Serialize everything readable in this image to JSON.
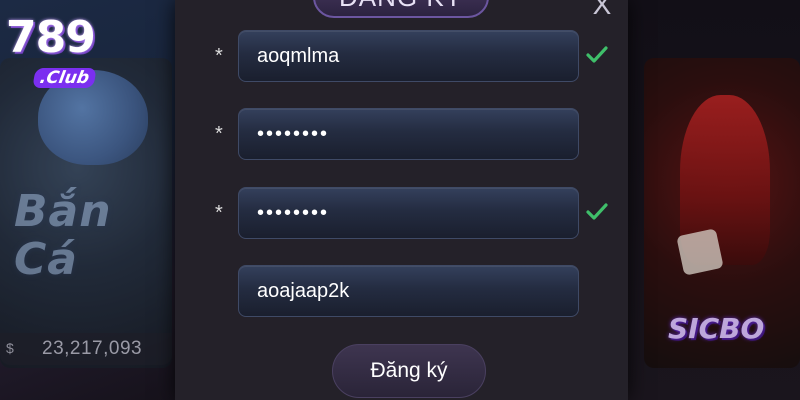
{
  "background": {
    "left_game": {
      "title": "Bắn Cá",
      "jackpot_currency": "$",
      "jackpot_amount": "23,217,093"
    },
    "right_game": {
      "title": "SICBO"
    },
    "logo": {
      "number": "789",
      "suffix": ".Club"
    }
  },
  "modal": {
    "title": "ĐĂNG KÝ",
    "close_label": "X",
    "fields": [
      {
        "required": "*",
        "value": "aoqmlma",
        "type": "username",
        "valid": true
      },
      {
        "required": "*",
        "value": "••••••••",
        "type": "password",
        "valid": false
      },
      {
        "required": "*",
        "value": "••••••••",
        "type": "confirm-password",
        "valid": true
      },
      {
        "required": "",
        "value": "aoajaap2k",
        "type": "referral",
        "valid": false
      }
    ],
    "submit_label": "Đăng ký"
  },
  "colors": {
    "check_green": "#3fbf6a",
    "accent_purple": "#7b2ff0"
  }
}
